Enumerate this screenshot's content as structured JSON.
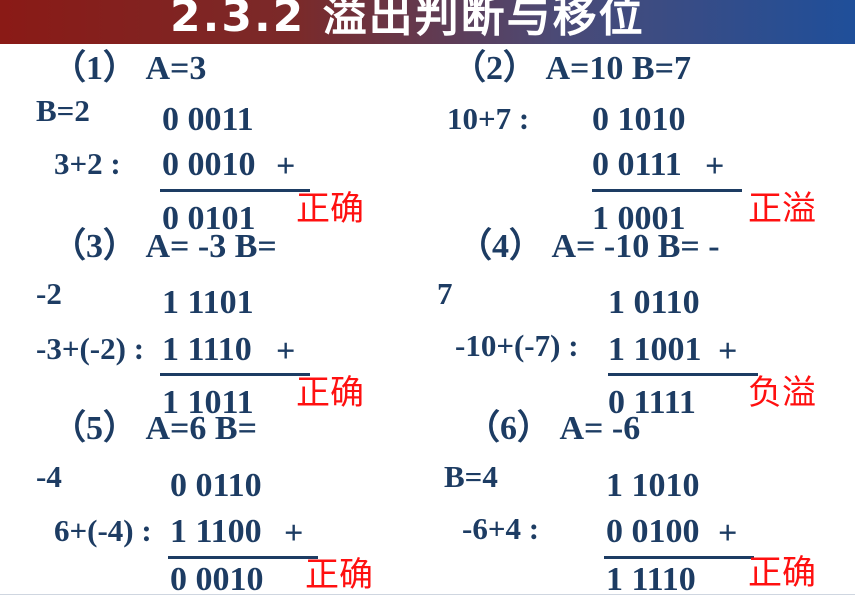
{
  "title": "2.3.2   溢出判断与移位",
  "problems": [
    {
      "head": "（1） A=3",
      "wrap": "B=2",
      "row1": "0 0011",
      "expr": "3+2 :",
      "row2": "0 0010",
      "plus": "+",
      "result": "0 0101",
      "verdict": "正确"
    },
    {
      "head": "（2） A=10  B=7",
      "wrap": "",
      "row1": "0 1010",
      "expr": "10+7 :",
      "row2": "0 0111",
      "plus": "+",
      "result": "1 0001",
      "verdict": "正溢"
    },
    {
      "head": "（3） A= -3  B=",
      "wrap": "-2",
      "row1": "1 1101",
      "expr": "-3+(-2) :",
      "row2": "1 1110",
      "plus": "+",
      "result": "1 1011",
      "verdict": "正确"
    },
    {
      "head": "（4） A= -10  B= -",
      "wrap": "7",
      "row1": "1 0110",
      "expr": "-10+(-7) :",
      "row2": "1 1001",
      "plus": "+",
      "result": "0 1111",
      "verdict": "负溢"
    },
    {
      "head": "（5） A=6  B=",
      "wrap": "-4",
      "row1": "0 0110",
      "expr": "6+(-4) :",
      "row2": "1 1100",
      "plus": "+",
      "result": "0 0010",
      "verdict": "正确"
    },
    {
      "head": "（6） A= -6",
      "wrap": "B=4",
      "row1": "1 1010",
      "expr": "-6+4 :",
      "row2": "0 0100",
      "plus": "+",
      "result": "1 1110",
      "verdict": "正确"
    }
  ],
  "colors": {
    "text": "#1d3c63",
    "verdict": "#ff1010"
  }
}
